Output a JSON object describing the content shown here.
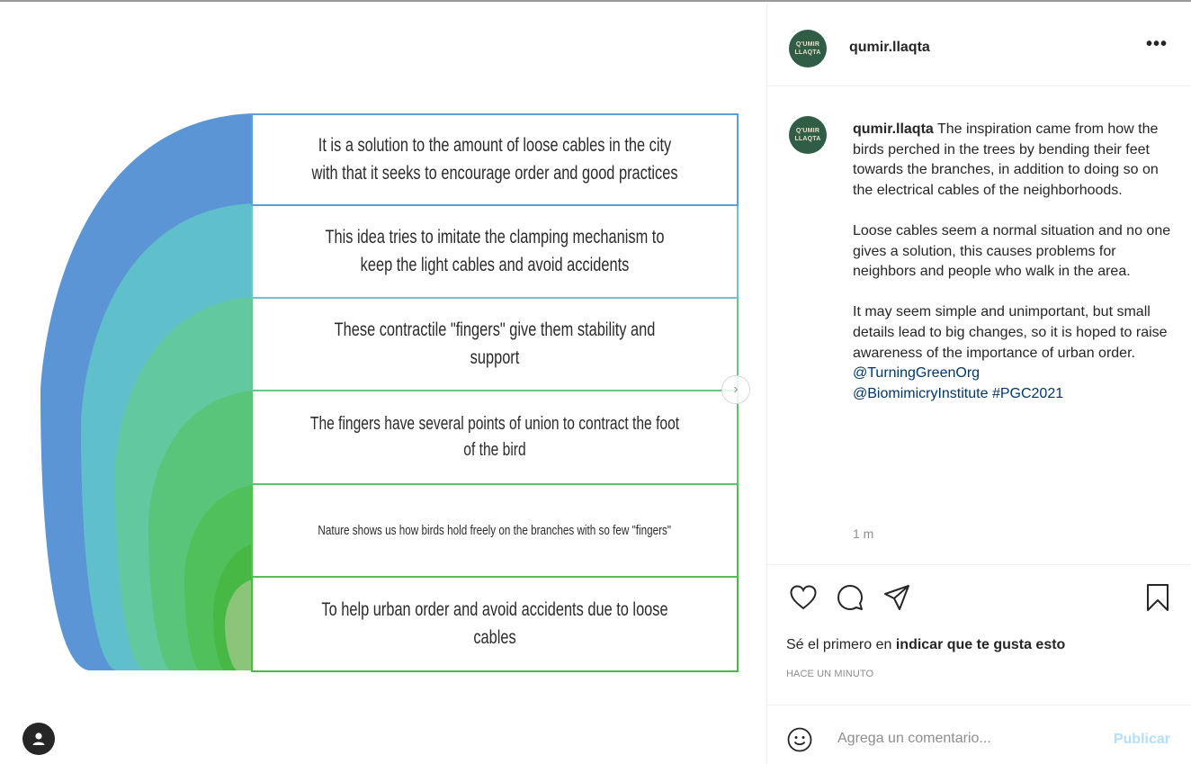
{
  "post": {
    "username": "qumir.llaqta",
    "avatar_text_line1": "Q'UMIR",
    "avatar_text_line2": "LLAQTA",
    "more_icon": "•••",
    "caption": {
      "username": "qumir.llaqta",
      "paragraph1": " The inspiration came from how the birds perched in the trees by bending their feet towards the branches, in addition to doing so on the electrical cables of the neighborhoods.",
      "paragraph2": "Loose cables seem a normal situation and no one gives a solution, this causes problems for neighbors and people who walk in the area.",
      "paragraph3": "It may seem simple and unimportant, but small details lead to big changes, so it is hoped to raise awareness of the importance of urban order.",
      "mention1": "@TurningGreenOrg",
      "mention2": "@BiomimicryInstitute",
      "hashtag": "#PGC2021"
    },
    "time": "1 m",
    "likes_prefix": "Sé el primero en ",
    "likes_bold": "indicar que te gusta esto",
    "ago": "HACE UN MINUTO",
    "comment_placeholder": "Agrega un comentario...",
    "publish_label": "Publicar"
  },
  "slide": {
    "rows": [
      "It is a solution to the amount of loose cables in the city with that it seeks to encourage order and good practices",
      "This idea tries to imitate the clamping mechanism to keep the light cables and avoid accidents",
      "These contractile \"fingers\" give them stability and support",
      "The fingers have several points of union to contract the foot of the bird",
      "Nature shows us how birds hold freely on the branches with so few \"fingers\"",
      "To help urban order and avoid accidents due to loose cables"
    ],
    "arch_colors": [
      "#5b95d6",
      "#5fc0cc",
      "#62c8a0",
      "#58c57a",
      "#4fc05a",
      "#48b845",
      "#8bc57a"
    ],
    "next_icon": "›"
  },
  "icons": {
    "like": "heart-icon",
    "comment": "comment-icon",
    "share": "send-icon",
    "save": "bookmark-icon",
    "emoji": "smiley-icon",
    "user_tag": "user-tag-icon",
    "next": "chevron-right-icon"
  }
}
